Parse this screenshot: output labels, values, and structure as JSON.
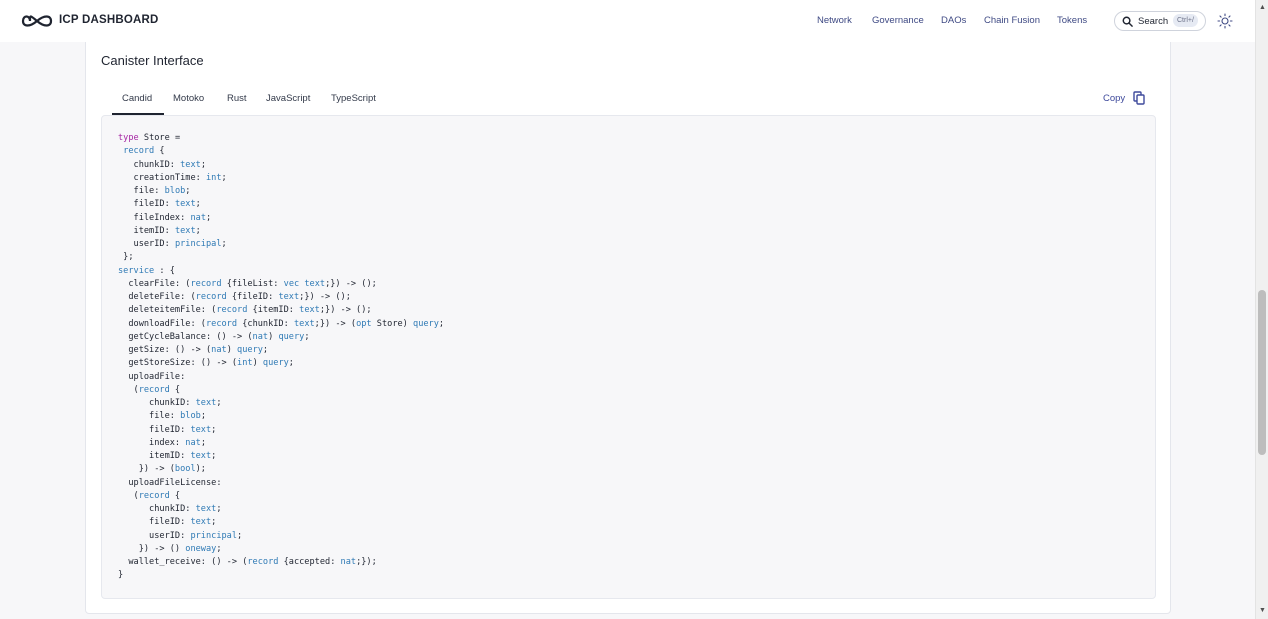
{
  "header": {
    "brand": "ICP DASHBOARD",
    "nav": [
      "Network",
      "Governance",
      "DAOs",
      "Chain Fusion",
      "Tokens"
    ],
    "search_label": "Search",
    "search_shortcut": "Ctrl+/",
    "icons": {
      "logo": "infinity-logo",
      "search": "search-icon",
      "theme": "sun-icon"
    }
  },
  "section": {
    "title": "Canister Interface",
    "tabs": [
      "Candid",
      "Motoko",
      "Rust",
      "JavaScript",
      "TypeScript"
    ],
    "active_tab": "Candid",
    "copy_label": "Copy"
  },
  "code": {
    "language": "Candid",
    "lines": [
      "type Store =",
      " record {",
      "   chunkID: text;",
      "   creationTime: int;",
      "   file: blob;",
      "   fileID: text;",
      "   fileIndex: nat;",
      "   itemID: text;",
      "   userID: principal;",
      " };",
      "service : {",
      "  clearFile: (record {fileList: vec text;}) -> ();",
      "  deleteFile: (record {fileID: text;}) -> ();",
      "  deleteitemFile: (record {itemID: text;}) -> ();",
      "  downloadFile: (record {chunkID: text;}) -> (opt Store) query;",
      "  getCycleBalance: () -> (nat) query;",
      "  getSize: () -> (nat) query;",
      "  getStoreSize: () -> (int) query;",
      "  uploadFile:",
      "   (record {",
      "      chunkID: text;",
      "      file: blob;",
      "      fileID: text;",
      "      index: nat;",
      "      itemID: text;",
      "    }) -> (bool);",
      "  uploadFileLicense:",
      "   (record {",
      "      chunkID: text;",
      "      fileID: text;",
      "      userID: principal;",
      "    }) -> () oneway;",
      "  wallet_receive: () -> (record {accepted: nat;});",
      "}"
    ]
  },
  "colors": {
    "keyword": "#a626a4",
    "type": "#2f7ab5",
    "accent": "#3f4a9c"
  }
}
